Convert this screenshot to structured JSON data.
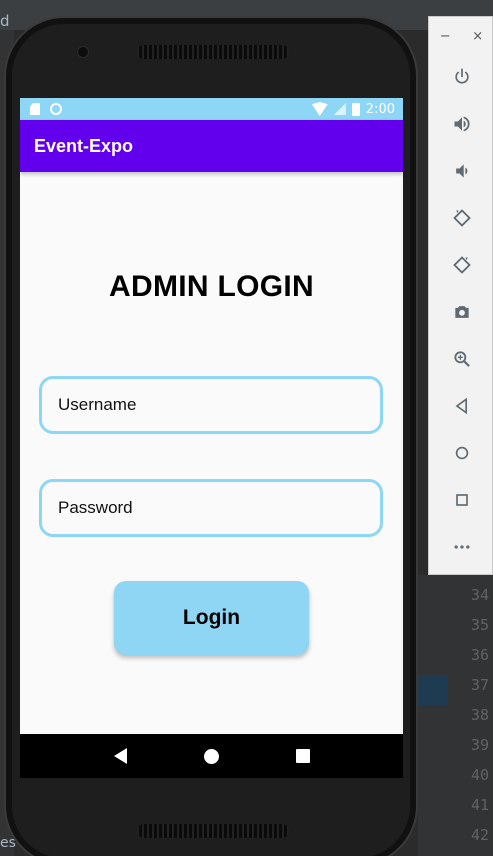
{
  "status_bar": {
    "time": "2:00"
  },
  "app": {
    "title": "Event-Expo"
  },
  "login": {
    "heading": "ADMIN LOGIN",
    "username_placeholder": "Username",
    "password_placeholder": "Password",
    "button_label": "Login"
  },
  "emulator_toolbar": {
    "minimize": "−",
    "close": "×",
    "tools": [
      "power-icon",
      "volume-up-icon",
      "volume-down-icon",
      "rotate-left-icon",
      "rotate-right-icon",
      "camera-icon",
      "zoom-icon",
      "back-icon",
      "home-icon",
      "overview-icon",
      "more-icon"
    ]
  },
  "ide": {
    "left_text": "d",
    "bottom_left_text": "es",
    "line_numbers": [
      "34",
      "35",
      "36",
      "37",
      "38",
      "39",
      "40",
      "41",
      "42"
    ]
  },
  "colors": {
    "status_bar": "#8ed6f5",
    "app_bar": "#6200ee",
    "field_border": "#8ed6f5",
    "button": "#8fd6f5"
  }
}
